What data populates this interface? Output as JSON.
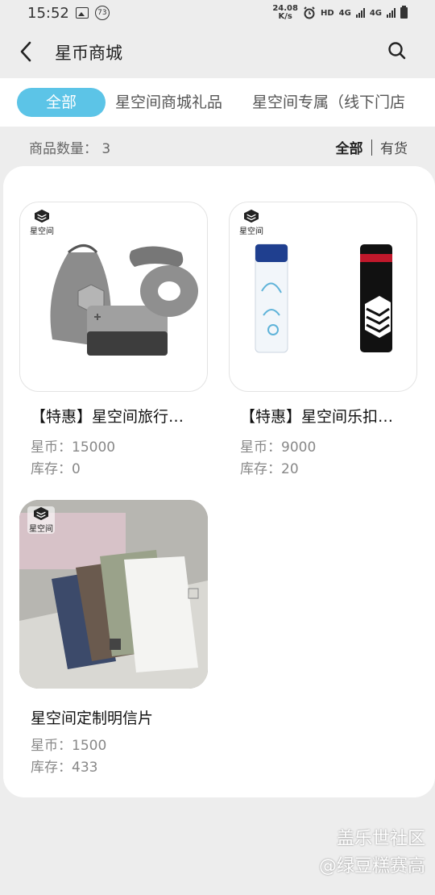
{
  "status_bar": {
    "time": "15:52",
    "notification_count": "73",
    "net_speed_value": "24.08",
    "net_speed_unit": "K/s",
    "hd_label": "HD",
    "net1": "4G",
    "net2": "4G"
  },
  "header": {
    "title": "星币商城",
    "back_icon": "chevron-left-icon",
    "search_icon": "search-icon"
  },
  "tabs": [
    {
      "label": "全部",
      "active": true
    },
    {
      "label": "星空间商城礼品",
      "active": false
    },
    {
      "label": "星空间专属（线下门店",
      "active": false
    }
  ],
  "count_bar": {
    "label": "商品数量：",
    "value": "3",
    "filter_all": "全部",
    "filter_in_stock": "有货"
  },
  "products": [
    {
      "name": "【特惠】星空间旅行…",
      "price_label": "星币：",
      "price": "15000",
      "stock_label": "库存：",
      "stock": "0",
      "logo_text": "星空间"
    },
    {
      "name": "【特惠】星空间乐扣…",
      "price_label": "星币：",
      "price": "9000",
      "stock_label": "库存：",
      "stock": "20",
      "logo_text": "星空间"
    },
    {
      "name": "星空间定制明信片",
      "price_label": "星币：",
      "price": "1500",
      "stock_label": "库存：",
      "stock": "433",
      "logo_text": "星空间"
    }
  ],
  "watermark": {
    "line1": "盖乐世社区",
    "line2": "@绿豆糕赛高"
  },
  "colors": {
    "accent": "#5cc4e7",
    "background": "#ededed"
  }
}
